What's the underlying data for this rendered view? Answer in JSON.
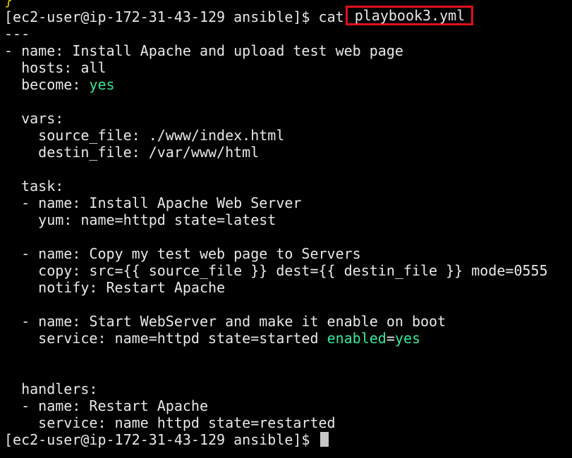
{
  "terminal": {
    "top_fragment": "}",
    "prompt": "[ec2-user@ip-172-31-43-129 ansible]$ ",
    "command": "cat ",
    "filename": "playbook3.yml",
    "highlight_color": "#e0101a",
    "keyword_color": "#39e69a",
    "lines": {
      "doc_start": "---",
      "name_play": "- name: Install Apache and upload test web page",
      "hosts": "  hosts: all",
      "become_key": "  become: ",
      "become_val": "yes",
      "blank1": "",
      "vars": "  vars:",
      "source_file": "    source_file: ./www/index.html",
      "destin_file": "    destin_file: /var/www/html",
      "blank2": "",
      "task": "  task:",
      "task1_name": "  - name: Install Apache Web Server",
      "task1_yum": "    yum: name=httpd state=latest",
      "blank3": "",
      "task2_name": "  - name: Copy my test web page to Servers",
      "task2_copy": "    copy: src={{ source_file }} dest={{ destin_file }} mode=0555",
      "task2_notify": "    notify: Restart Apache",
      "blank4": "",
      "task3_name": "  - name: Start WebServer and make it enable on boot",
      "task3_service_pre": "    service: name=httpd state=started ",
      "task3_enabled": "enabled",
      "task3_eq": "=",
      "task3_yes": "yes",
      "blank5": "",
      "blank6": "",
      "handlers": "  handlers:",
      "handler_name": "  - name: Restart Apache",
      "handler_service": "    service: name httpd state=restarted"
    },
    "final_prompt": "[ec2-user@ip-172-31-43-129 ansible]$ "
  }
}
